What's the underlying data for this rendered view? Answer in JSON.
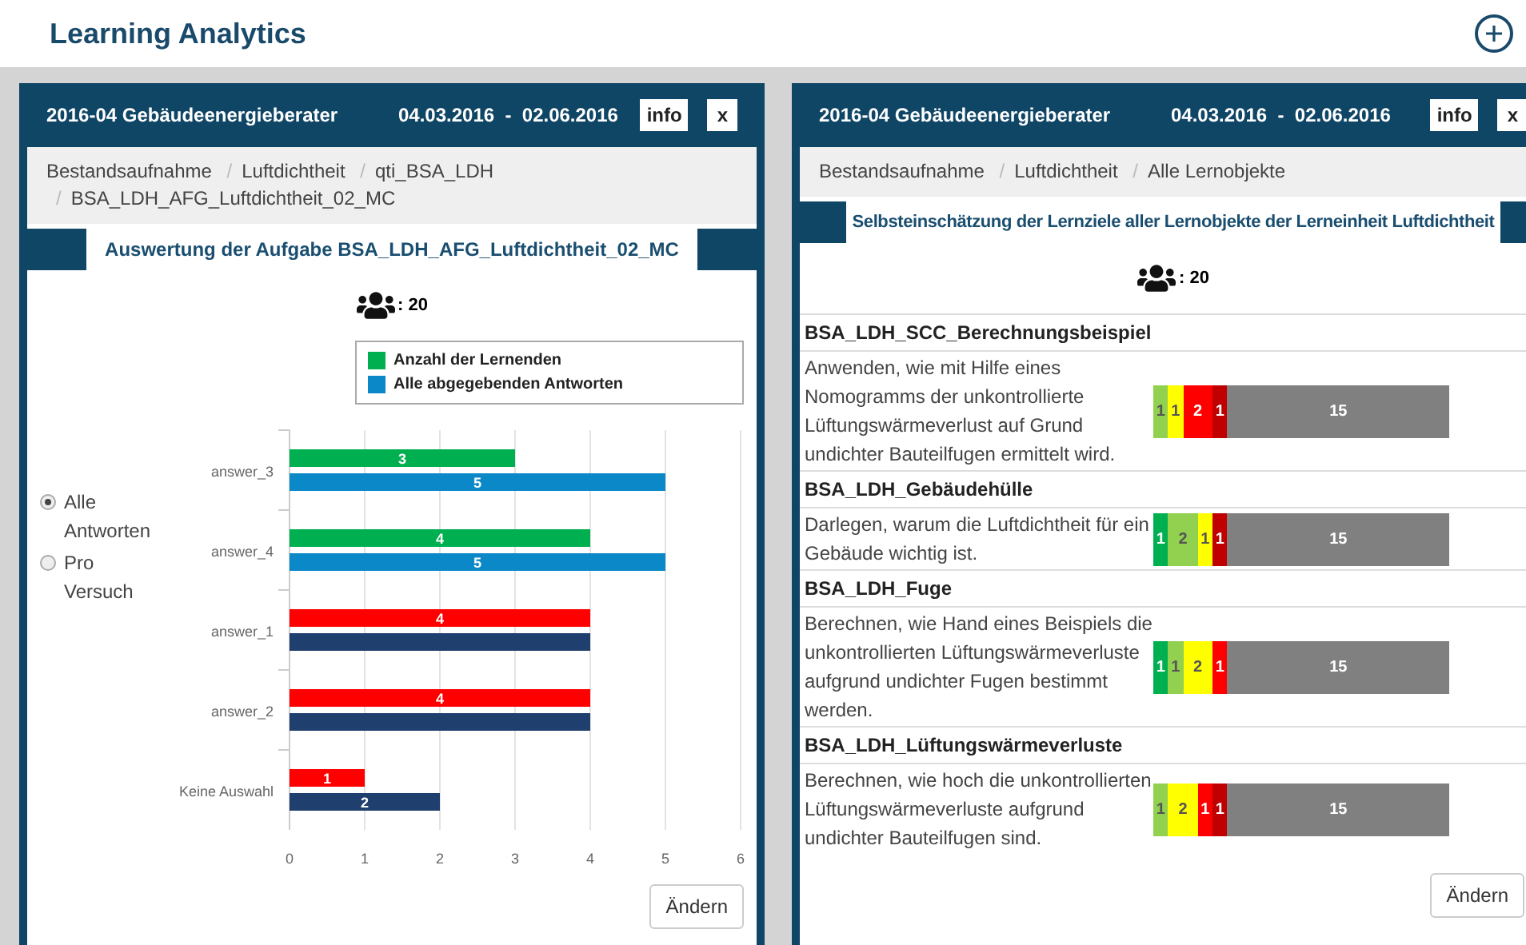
{
  "page_title": "Learning Analytics",
  "panels": [
    {
      "kind": "chart",
      "course": "2016-04 Gebäudeenergieberater",
      "dates": "04.03.2016  -  02.06.2016",
      "info_label": "info",
      "close_label": "x",
      "breadcrumb": [
        "Bestandsaufnahme",
        "Luftdichtheit",
        "qti_BSA_LDH",
        "BSA_LDH_AFG_Luftdichtheit_02_MC"
      ],
      "breadcrumb_separator": "/",
      "section_title": "Auswertung der Aufgabe BSA_LDH_AFG_Luftdichtheit_02_MC",
      "participants": ": 20",
      "options": [
        {
          "label": "Alle Antworten",
          "selected": true
        },
        {
          "label": "Pro Versuch",
          "selected": false
        }
      ],
      "chart_data": {
        "type": "bar",
        "orientation": "horizontal",
        "grid": true,
        "legend": "top right",
        "categories": [
          "answer_3",
          "answer_4",
          "answer_1",
          "answer_2",
          "Keine Auswahl"
        ],
        "series": [
          {
            "name": "Anzahl der Lernenden",
            "color": "#00b050",
            "values": [
              3,
              4,
              null,
              null,
              null
            ]
          },
          {
            "name": "Alle abgegebenden Antworten",
            "color": "#0a88c8",
            "values": [
              5,
              5,
              null,
              null,
              null
            ]
          },
          {
            "color": "#ff0000",
            "values": [
              null,
              null,
              4,
              4,
              1
            ]
          },
          {
            "color": "#1f3f6e",
            "values": [
              null,
              null,
              4,
              4,
              2
            ]
          }
        ],
        "xlim": [
          0,
          6
        ],
        "xticks": [
          0,
          1,
          2,
          3,
          4,
          5,
          6
        ],
        "value_labels": [
          [
            "3",
            "4",
            null,
            null,
            null
          ],
          [
            "5",
            "5",
            null,
            null,
            null
          ],
          [
            null,
            null,
            "4",
            "4",
            "1"
          ],
          [
            null,
            null,
            null,
            null,
            "2"
          ]
        ]
      },
      "button": "Ändern"
    },
    {
      "kind": "objectives",
      "course": "2016-04 Gebäudeenergieberater",
      "dates": "04.03.2016  -  02.06.2016",
      "info_label": "info",
      "close_label": "x",
      "breadcrumb": [
        "Bestandsaufnahme",
        "Luftdichtheit",
        "Alle Lernobjekte"
      ],
      "breadcrumb_separator": "/",
      "section_title": "Selbsteinschätzung der Lernziele aller Lernobjekte der Lerneinheit Luftdichtheit",
      "participants": ": 20",
      "objectives": [
        {
          "name": "BSA_LDH_SCC_Berechnungsbeispiel",
          "text": "Anwenden, wie mit Hilfe eines Nomogramms der unkontrollierte Lüftungswärmeverlust auf Grund undichter Bauteilfugen ermittelt wird.",
          "segments": [
            {
              "value": "1",
              "color": "#92d050"
            },
            {
              "value": "1",
              "color": "#ffff00"
            },
            {
              "value": "2",
              "color": "#ff0000"
            },
            {
              "value": "1",
              "color": "#c00000"
            },
            {
              "value": "15",
              "color": "#808080"
            }
          ]
        },
        {
          "name": "BSA_LDH_Gebäudehülle",
          "text": "Darlegen, warum die Luftdichtheit für ein Gebäude wichtig ist.",
          "segments": [
            {
              "value": "1",
              "color": "#00b050"
            },
            {
              "value": "2",
              "color": "#92d050"
            },
            {
              "value": "1",
              "color": "#ffff00"
            },
            {
              "value": "1",
              "color": "#c00000"
            },
            {
              "value": "15",
              "color": "#808080"
            }
          ]
        },
        {
          "name": "BSA_LDH_Fuge",
          "text": "Berechnen, wie Hand eines Beispiels die unkontrollierten Lüftungswärmeverluste aufgrund undichter Fugen bestimmt werden.",
          "segments": [
            {
              "value": "1",
              "color": "#00b050"
            },
            {
              "value": "1",
              "color": "#92d050"
            },
            {
              "value": "2",
              "color": "#ffff00"
            },
            {
              "value": "1",
              "color": "#ff0000"
            },
            {
              "value": "15",
              "color": "#808080"
            }
          ]
        },
        {
          "name": "BSA_LDH_Lüftungswärmeverluste",
          "text": "Berechnen, wie hoch die unkontrollierten Lüftungswärmeverluste aufgrund undichter Bauteilfugen sind.",
          "segments": [
            {
              "value": "1",
              "color": "#92d050"
            },
            {
              "value": "2",
              "color": "#ffff00"
            },
            {
              "value": "1",
              "color": "#ff0000"
            },
            {
              "value": "1",
              "color": "#c00000"
            },
            {
              "value": "15",
              "color": "#808080"
            }
          ]
        }
      ],
      "button": "Ändern"
    }
  ]
}
